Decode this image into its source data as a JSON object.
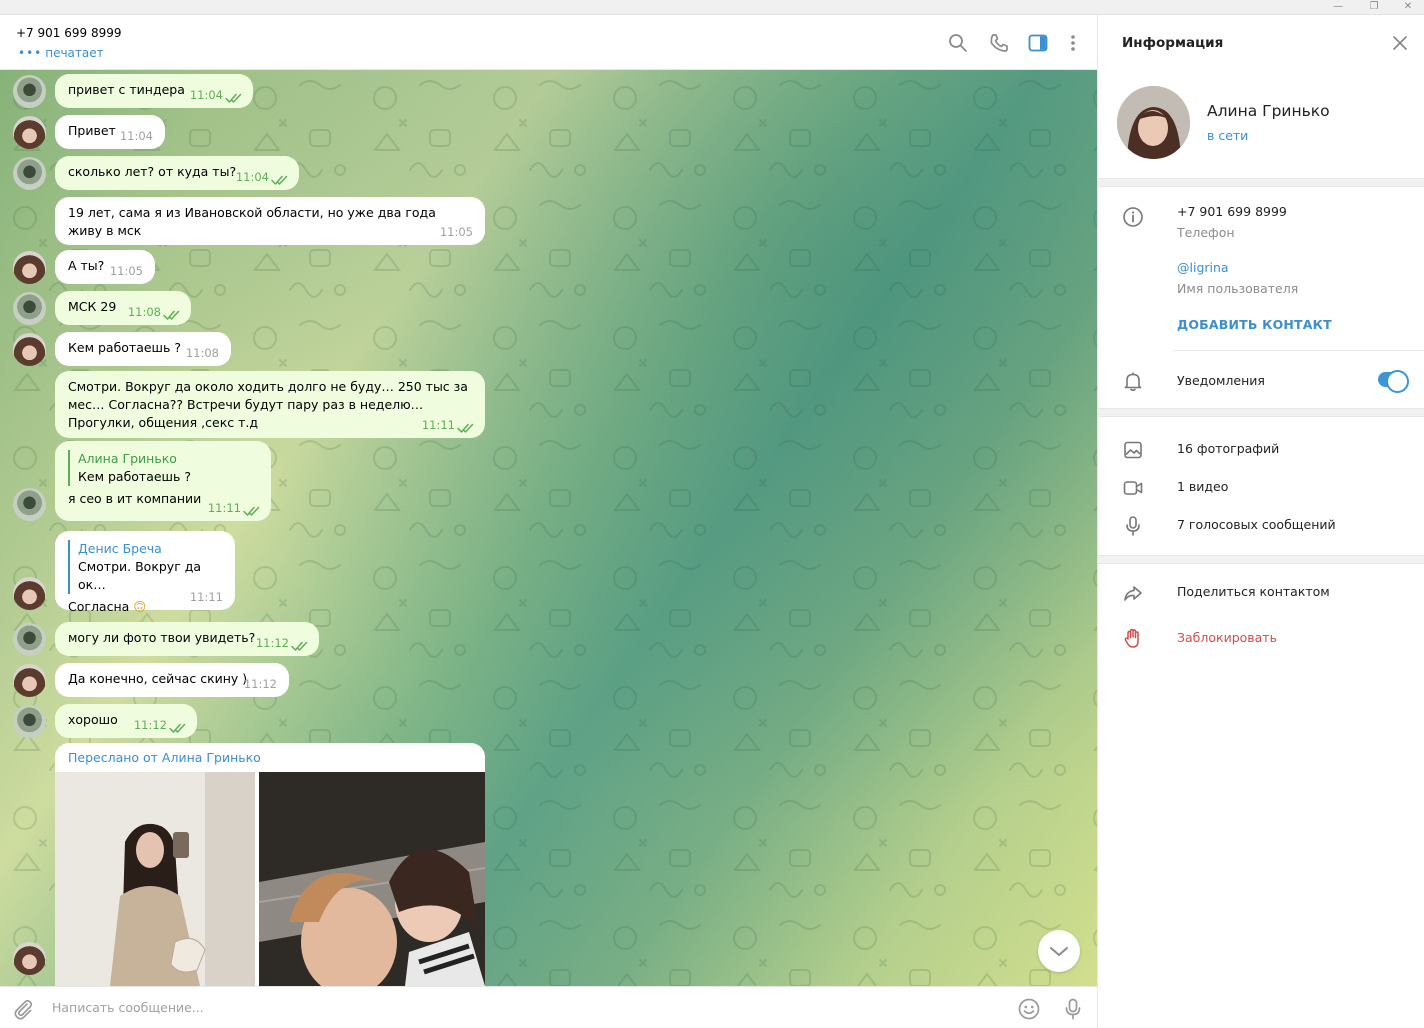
{
  "window": {
    "minimize": "—",
    "maximize": "❐",
    "close": "✕"
  },
  "header": {
    "peer_name": "+7 901 699 8999",
    "peer_status": "печатает",
    "icons": [
      "search-icon",
      "phone-icon",
      "sidebar-toggle-icon",
      "more-vertical-icon"
    ]
  },
  "messages": [
    {
      "dir": "out",
      "text": "привет с тиндера",
      "time": "11:04",
      "read": true
    },
    {
      "dir": "in",
      "text": "Привет",
      "time": "11:04"
    },
    {
      "dir": "out",
      "text": "сколько лет? от куда ты?",
      "time": "11:04",
      "read": true
    },
    {
      "dir": "in",
      "text": "19 лет, сама я из Ивановской области, но уже два года живу в мск",
      "time": "11:05"
    },
    {
      "dir": "in",
      "text": "А ты?",
      "time": "11:05"
    },
    {
      "dir": "out",
      "text": "МСК 29",
      "time": "11:08",
      "read": true
    },
    {
      "dir": "in",
      "text": "Кем работаешь ?",
      "time": "11:08"
    },
    {
      "dir": "out",
      "text": "Смотри. Вокруг да около ходить долго не буду… 250 тыс за мес… Согласна?? Встречи будут пару раз в неделю… Прогулки, общения ,секс  т.д",
      "time": "11:11",
      "read": true
    },
    {
      "dir": "out",
      "reply_name": "Алина Гринько",
      "reply_text": "Кем работаешь ?",
      "text": "я сео в ит компании",
      "time": "11:11",
      "read": true
    },
    {
      "dir": "in",
      "reply_name": "Денис Бреча",
      "reply_text": "Смотри. Вокруг да ок…",
      "text": "Согласна",
      "emoji": "🙃",
      "time": "11:11"
    },
    {
      "dir": "out",
      "text": "могу ли фото твои увидеть?",
      "time": "11:12",
      "read": true
    },
    {
      "dir": "in",
      "text": "Да конечно, сейчас скину )",
      "time": "11:12"
    },
    {
      "dir": "out",
      "text": "хорошо",
      "time": "11:12",
      "read": true
    }
  ],
  "forwarded": {
    "title": "Переслано от Алина Гринько"
  },
  "compose": {
    "placeholder": "Написать сообщение..."
  },
  "info": {
    "title": "Информация",
    "name": "Алина Гринько",
    "status": "в сети",
    "phone": "+7 901 699 8999",
    "phone_label": "Телефон",
    "username": "@ligrina",
    "username_label": "Имя пользователя",
    "add_contact": "ДОБАВИТЬ КОНТАКТ",
    "notifications": "Уведомления",
    "notifications_on": true,
    "media": {
      "photos": "16 фотографий",
      "videos": "1 видео",
      "voice": "7 голосовых сообщений"
    },
    "share_contact": "Поделиться контактом",
    "block": "Заблокировать"
  },
  "colors": {
    "accent": "#3a8fd0",
    "outgoing_bubble": "#effdde",
    "read_ticks": "#5fae56",
    "danger": "#d14d4d"
  }
}
